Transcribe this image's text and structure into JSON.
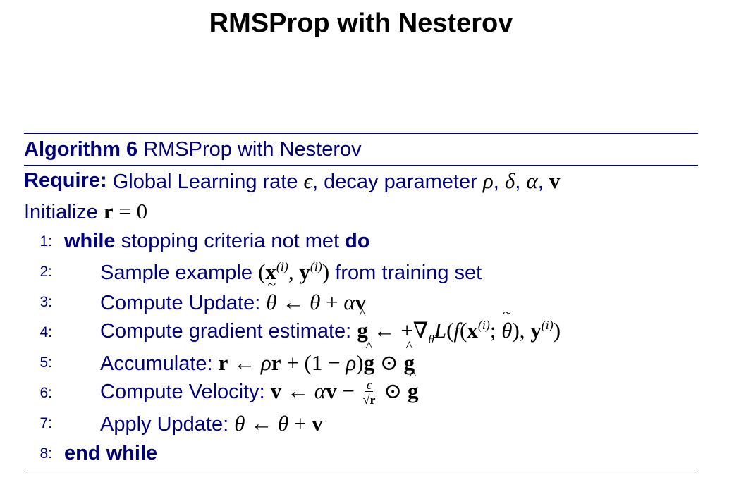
{
  "title": "RMSProp with Nesterov",
  "algorithm": {
    "label": "Algorithm 6",
    "name": "RMSProp with Nesterov",
    "require_label": "Require:",
    "require_text": "Global Learning rate ϵ, decay parameter ρ, δ, α, v",
    "init_text": "Initialize r = 0",
    "lines": [
      {
        "num": "1:",
        "keyword_start": "while",
        "text": "stopping criteria not met",
        "keyword_end": "do"
      },
      {
        "num": "2:",
        "text": "Sample example (x(i), y(i)) from training set"
      },
      {
        "num": "3:",
        "text": "Compute Update: θ̃ ← θ + αv"
      },
      {
        "num": "4:",
        "text": "Compute gradient estimate: ĝ ← +∇θ̃ L(f(x(i); θ̃), y(i))"
      },
      {
        "num": "5:",
        "text": "Accumulate: r ← ρr + (1 − ρ)ĝ ⊙ ĝ"
      },
      {
        "num": "6:",
        "text": "Compute Velocity: v ← αv − ϵ/√r ⊙ ĝ"
      },
      {
        "num": "7:",
        "text": "Apply Update: θ ← θ + v"
      },
      {
        "num": "8:",
        "keyword_start": "end while"
      }
    ]
  },
  "colors": {
    "algorithm_text": "#00007a",
    "title": "#000000"
  }
}
